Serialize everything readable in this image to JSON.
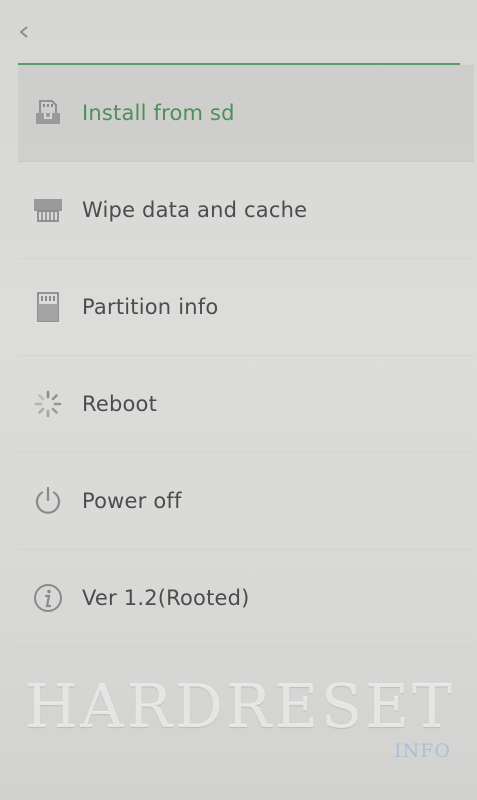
{
  "header": {
    "back_icon": "chevron-left-icon"
  },
  "colors": {
    "accent": "#5d9a6b",
    "selected_text": "#4f8e58",
    "text": "#4c4c4c",
    "icon": "#8a8a8a"
  },
  "menu": {
    "items": [
      {
        "label": "Install from sd",
        "icon": "sd-install-icon",
        "selected": true
      },
      {
        "label": "Wipe data and cache",
        "icon": "wipe-icon",
        "selected": false
      },
      {
        "label": "Partition info",
        "icon": "sd-card-icon",
        "selected": false
      },
      {
        "label": "Reboot",
        "icon": "spinner-icon",
        "selected": false
      },
      {
        "label": "Power off",
        "icon": "power-icon",
        "selected": false
      },
      {
        "label": "Ver 1.2(Rooted)",
        "icon": "info-icon",
        "selected": false
      }
    ]
  },
  "watermark": {
    "brand": "HARDRESET",
    "sub": "INFO"
  }
}
